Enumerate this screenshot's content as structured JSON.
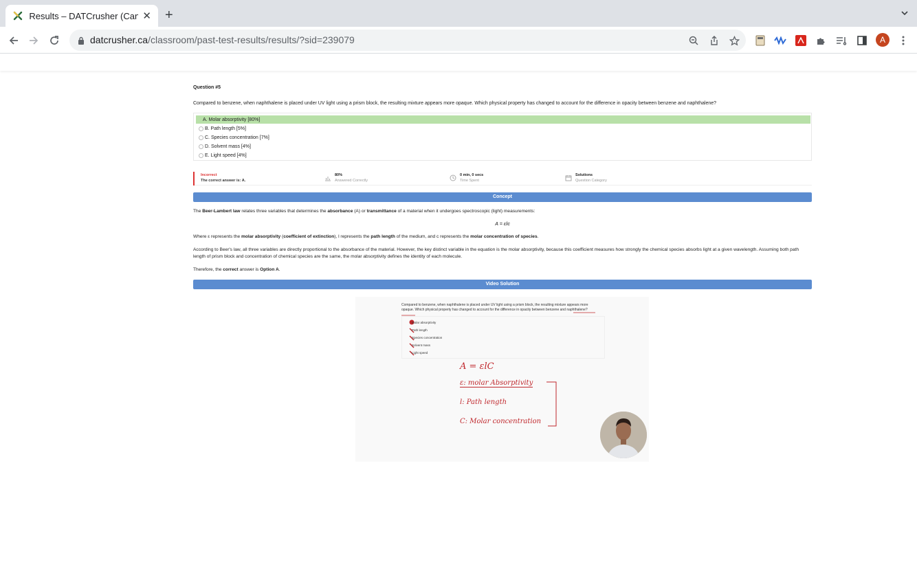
{
  "browser": {
    "tab_title": "Results – DATCrusher (Canadian",
    "url_host": "datcrusher.ca",
    "url_path": "/classroom/past-test-results/results/?sid=239079",
    "avatar_letter": "A"
  },
  "question": {
    "number_label": "Question #5",
    "text": "Compared to benzene, when naphthalene is placed under UV light using a prism block, the resulting mixture appears more opaque. Which physical property has changed to account for the difference in opacity between benzene and naphthalene?",
    "options": [
      {
        "label": "A. Molar absorptivity [80%]",
        "correct": true
      },
      {
        "label": "B. Path length [5%]",
        "correct": false
      },
      {
        "label": "C. Species concentration [7%]",
        "correct": false
      },
      {
        "label": "D. Solvent mass [4%]",
        "correct": false
      },
      {
        "label": "E. Light speed [4%]",
        "correct": false
      }
    ]
  },
  "stats": {
    "status": "Incorrect",
    "correct_answer": "The correct answer is: A.",
    "answered_value": "80%",
    "answered_label": "Answered Correctly",
    "time_value": "0 min, 0 secs",
    "time_label": "Time Spent",
    "category_value": "Solutions",
    "category_label": "Question Category"
  },
  "concept": {
    "header": "Concept",
    "p1_a": "The ",
    "p1_b": "Beer-Lambert law",
    "p1_c": " relates three variables that determines the ",
    "p1_d": "absorbance",
    "p1_e": " (A) or ",
    "p1_f": "transmittance",
    "p1_g": " of a material when it undergoes spectroscopic (light) measurements:",
    "formula": "A = εlc",
    "p2_a": "Where ε represents the ",
    "p2_b": "molar absorptivity",
    "p2_c": " (",
    "p2_d": "coefficient of extinction",
    "p2_e": "), l represents the ",
    "p2_f": "path length",
    "p2_g": " of the medium, and c represents the ",
    "p2_h": "molar concentration of species",
    "p2_i": ".",
    "p3": "According to Beer's law, all three variables are directly proportional to the absorbance of the material. However, the key distinct variable in the equation is the molar absorptivity, because this coefficient measures how strongly the chemical species absorbs light at a given wavelength. Assuming both path length of prism block and concentration of chemical species are the same, the molar absorptivity defines the identity of each molecule.",
    "p4_a": "Therefore, the ",
    "p4_b": "correct",
    "p4_c": " answer is ",
    "p4_d": "Option A",
    "p4_e": "."
  },
  "video": {
    "header": "Video Solution",
    "q_text": "Compared to benzene, when naphthalene is placed under UV light using a prism block, the resulting mixture appears more opaque. Which physical property has changed to account for the difference in opacity between benzene and naphthalene?",
    "options": [
      "Molar absorptivity",
      "Path length",
      "Species concentration",
      "Solvent mass",
      "Light speed"
    ],
    "hw_lines": [
      "A = εlC",
      "ε: molar Absorptivity",
      "l: Path length",
      "C: Molar concentration"
    ]
  },
  "colors": {
    "accent_blue": "#5b8cd0",
    "correct_green": "#b8e0a8",
    "incorrect_red": "#d33333",
    "ink_red": "#c0282d"
  }
}
